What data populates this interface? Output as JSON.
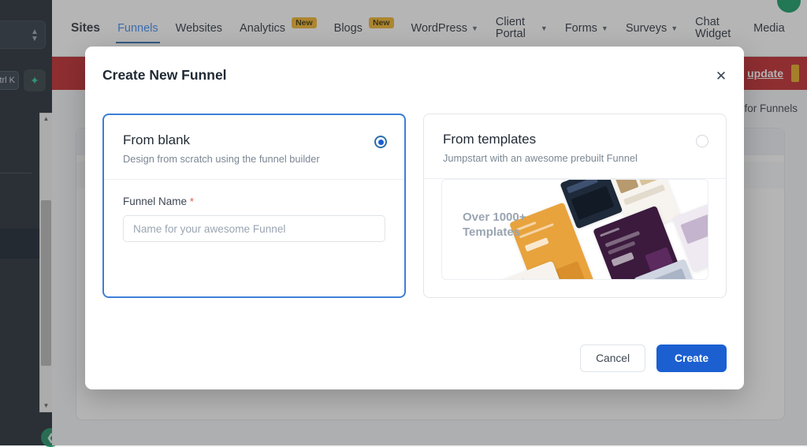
{
  "nav": {
    "brand": "Sites",
    "items": [
      {
        "label": "Funnels",
        "active": true,
        "badge": null,
        "caret": false
      },
      {
        "label": "Websites",
        "active": false,
        "badge": null,
        "caret": false
      },
      {
        "label": "Analytics",
        "active": false,
        "badge": "New",
        "caret": false
      },
      {
        "label": "Blogs",
        "active": false,
        "badge": "New",
        "caret": false
      },
      {
        "label": "WordPress",
        "active": false,
        "badge": null,
        "caret": true
      },
      {
        "label": "Client Portal",
        "active": false,
        "badge": null,
        "caret": true
      },
      {
        "label": "Forms",
        "active": false,
        "badge": null,
        "caret": true
      },
      {
        "label": "Surveys",
        "active": false,
        "badge": null,
        "caret": true
      },
      {
        "label": "Chat Widget",
        "active": false,
        "badge": null,
        "caret": false
      },
      {
        "label": "Media",
        "active": false,
        "badge": null,
        "caret": false
      }
    ]
  },
  "banner": {
    "text": "update"
  },
  "page": {
    "subhead": "for Funnels"
  },
  "sidebar": {
    "shortcut": "trl K"
  },
  "modal": {
    "title": "Create New Funnel",
    "close_icon": "close-icon",
    "blank": {
      "title": "From blank",
      "subtitle": "Design from scratch using the funnel builder",
      "selected": true,
      "field_label": "Funnel Name",
      "required_mark": "*",
      "field_value": "",
      "field_placeholder": "Name for your awesome Funnel"
    },
    "templates": {
      "title": "From templates",
      "subtitle": "Jumpstart with an awesome prebuilt Funnel",
      "selected": false,
      "preview_line1": "Over 1000+",
      "preview_line2": "Templates"
    },
    "cancel_label": "Cancel",
    "create_label": "Create"
  },
  "colors": {
    "accent_blue": "#1b5fd1",
    "selected_border": "#3d7fd6",
    "banner_red": "#c0262b",
    "badge_yellow": "#f0b429",
    "required_red": "#e8563f",
    "avatar_green": "#139b63"
  }
}
